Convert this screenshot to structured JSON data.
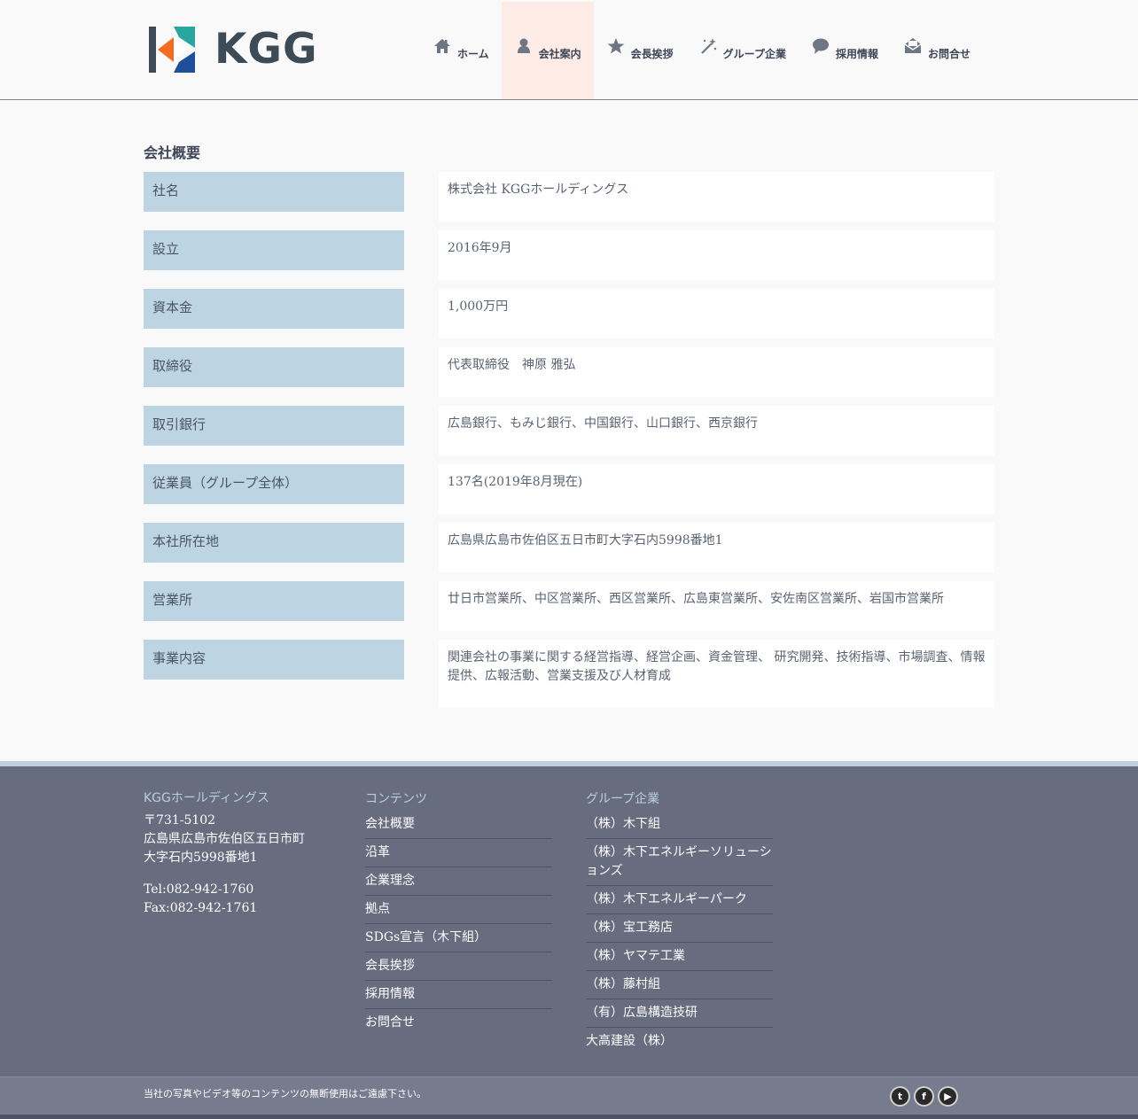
{
  "brand": {
    "name": "KGG",
    "colors": {
      "orange": "#f26b21",
      "teal": "#2aa6a2",
      "blue": "#1e4f9c",
      "dark": "#3d4b57"
    }
  },
  "nav": [
    {
      "label": "ホーム",
      "icon": "home-icon",
      "active": false
    },
    {
      "label": "会社案内",
      "icon": "person-icon",
      "active": true
    },
    {
      "label": "会長挨拶",
      "icon": "star-icon",
      "active": false
    },
    {
      "label": "グループ企業",
      "icon": "magic-wand-icon",
      "active": false
    },
    {
      "label": "採用情報",
      "icon": "chat-bubble-icon",
      "active": false
    },
    {
      "label": "お問合せ",
      "icon": "envelope-icon",
      "active": false
    }
  ],
  "overview": {
    "title": "会社概要",
    "rows": [
      {
        "label": "社名",
        "value": "株式会社 KGGホールディングス"
      },
      {
        "label": "設立",
        "value": "2016年9月"
      },
      {
        "label": "資本金",
        "value": "1,000万円"
      },
      {
        "label": "取締役",
        "value": "代表取締役　神原 雅弘"
      },
      {
        "label": "取引銀行",
        "value": "広島銀行、もみじ銀行、中国銀行、山口銀行、西京銀行"
      },
      {
        "label": "従業員（グループ全体）",
        "value": "137名(2019年8月現在)"
      },
      {
        "label": "本社所在地",
        "value": "広島県広島市佐伯区五日市町大字石内5998番地1"
      },
      {
        "label": "営業所",
        "value": "廿日市営業所、中区営業所、西区営業所、広島東営業所、安佐南区営業所、岩国市営業所"
      },
      {
        "label": "事業内容",
        "value": "関連会社の事業に関する経営指導、経営企画、資金管理、 研究開発、技術指導、市場調査、情報提供、広報活動、営業支援及び人材育成"
      }
    ]
  },
  "footer": {
    "company": {
      "title": "KGGホールディングス",
      "postal": "〒731-5102",
      "address1": "広島県広島市佐伯区五日市町",
      "address2": "大字石内5998番地1",
      "tel": "Tel:082-942-1760",
      "fax": "Fax:082-942-1761"
    },
    "contents": {
      "title": "コンテンツ",
      "links": [
        "会社概要",
        "沿革",
        "企業理念",
        "拠点",
        "SDGs宣言（木下組）",
        "会長挨拶",
        "採用情報",
        "お問合せ"
      ]
    },
    "group": {
      "title": "グループ企業",
      "links": [
        "（株）木下組",
        "（株）木下エネルギーソリューションズ",
        "（株）木下エネルギーパーク",
        "（株）宝工務店",
        "（株）ヤマテ工業",
        "（株）藤村組",
        "（有）広島構造技研",
        "大高建設（株）"
      ]
    },
    "copyright": "当社の写真やビデオ等のコンテンツの無断使用はご遠慮下さい。",
    "social": [
      {
        "icon": "twitter-icon",
        "glyph": "t"
      },
      {
        "icon": "facebook-icon",
        "glyph": "f"
      },
      {
        "icon": "youtube-icon",
        "glyph": "▶"
      }
    ]
  }
}
